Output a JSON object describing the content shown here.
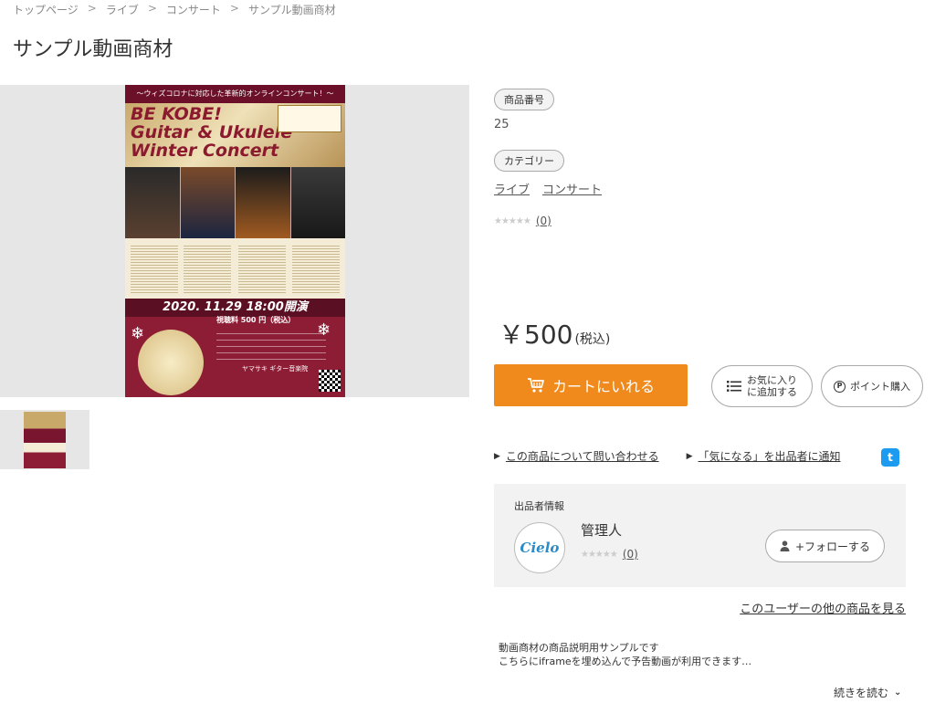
{
  "breadcrumb": [
    "トップページ",
    "ライブ",
    "コンサート",
    "サンプル動画商材"
  ],
  "breadcrumb_sep": ">",
  "page_title": "サンプル動画商材",
  "poster": {
    "banner": "〜ウィズコロナに対応した革新的オンラインコンサート！〜",
    "headline_1": "BE KOBE!",
    "headline_2": "Guitar & Ukulele",
    "headline_3": "Winter Concert",
    "date": "2020. 11.29 18:00開演",
    "fee": "視聴料 500 円（税込）",
    "organizer": "ヤマサキ ギター音楽院"
  },
  "product": {
    "number_label": "商品番号",
    "number_value": "25",
    "category_label": "カテゴリー",
    "categories": [
      "ライブ",
      "コンサート"
    ],
    "rating_count": "(0)",
    "price_amount": "￥500",
    "price_tax": "(税込)",
    "cart_button": "カートにいれる",
    "favorite_line1": "お気に入り",
    "favorite_line2": "に追加する",
    "point_button": "ポイント購入",
    "inquiry_link": "この商品について問い合わせる",
    "notify_link": "「気になる」を出品者に通知"
  },
  "seller": {
    "heading": "出品者情報",
    "name": "管理人",
    "avatar_text": "Cielo",
    "rating_count": "(0)",
    "follow_button": "+フォローする",
    "other_items_link": "このユーザーの他の商品を見る"
  },
  "description": {
    "line1": "動画商材の商品説明用サンプルです",
    "line2": "こちらにiframeを埋め込んで予告動画が利用できます…",
    "read_more": "続きを読む"
  },
  "colors": {
    "cart": "#f08a1c",
    "twitter": "#1d9bf0",
    "seller_bg": "#f2f2f2"
  }
}
